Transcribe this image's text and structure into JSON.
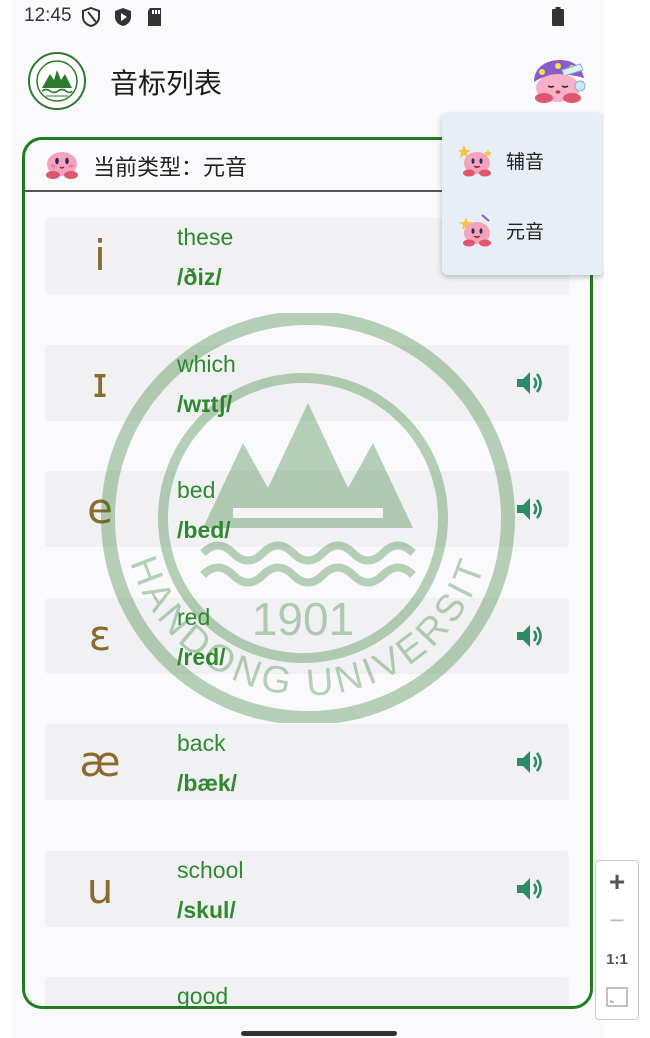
{
  "status_bar": {
    "time": "12:45"
  },
  "app_bar": {
    "title": "音标列表"
  },
  "type_header": {
    "label": "当前类型：元音"
  },
  "watermark": {
    "year": "1901",
    "name": "SHANDONG UNIVERSITY"
  },
  "phonemes": [
    {
      "symbol": "i",
      "word": "these",
      "ipa": "/ðiz/",
      "speaker": false
    },
    {
      "symbol": "ɪ",
      "word": "which",
      "ipa": "/wɪtʃ/",
      "speaker": true
    },
    {
      "symbol": "e",
      "word": "bed",
      "ipa": "/bed/",
      "speaker": true
    },
    {
      "symbol": "ɛ",
      "word": "red",
      "ipa": "/red/",
      "speaker": true
    },
    {
      "symbol": "æ",
      "word": "back",
      "ipa": "/bæk/",
      "speaker": true
    },
    {
      "symbol": "u",
      "word": "school",
      "ipa": "/skul/",
      "speaker": true
    },
    {
      "symbol": "",
      "word": "good",
      "ipa": "",
      "speaker": false
    }
  ],
  "dropdown": {
    "items": [
      {
        "label": "辅音",
        "icon": "kirby-star-icon"
      },
      {
        "label": "元音",
        "icon": "kirby-star-icon"
      }
    ]
  },
  "zoom": {
    "plus": "+",
    "minus": "−",
    "reset": "1:1"
  },
  "colors": {
    "accent": "#1e7d1e",
    "word": "#2f8a2f",
    "symbol": "#8a6b2d",
    "speaker": "#2e8a64"
  }
}
